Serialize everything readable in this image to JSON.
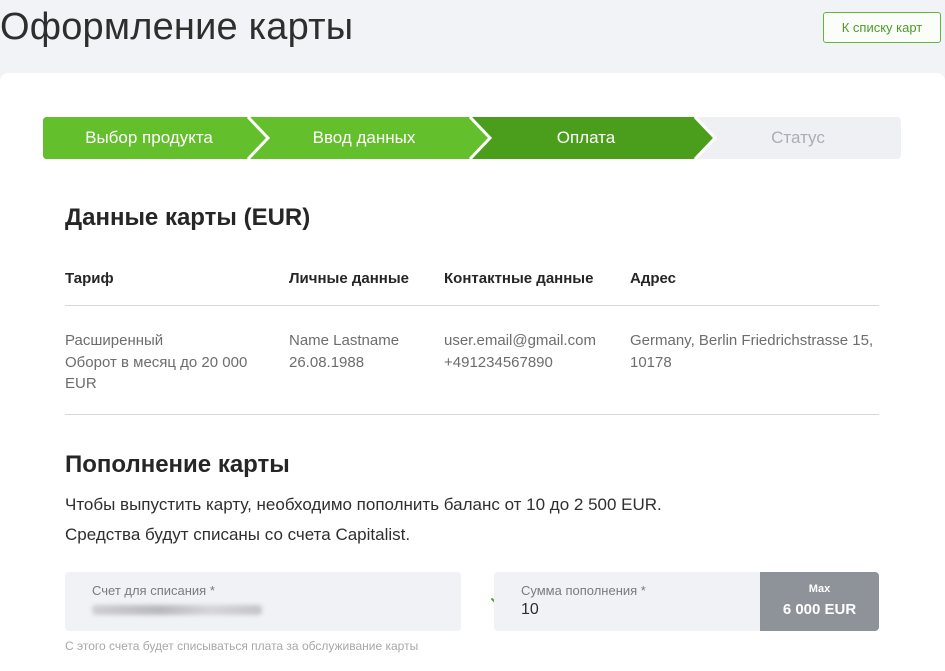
{
  "header": {
    "title": "Оформление карты",
    "back_button": "К списку карт"
  },
  "steps": [
    {
      "label": "Выбор продукта",
      "state": "done"
    },
    {
      "label": "Ввод данных",
      "state": "done"
    },
    {
      "label": "Оплата",
      "state": "active"
    },
    {
      "label": "Статус",
      "state": "inactive"
    }
  ],
  "colors": {
    "step_done": "#63bf2b",
    "step_active": "#4a9e1c",
    "step_inactive": "#eef0f3",
    "accent": "#63b63d"
  },
  "card_data": {
    "title": "Данные карты (EUR)",
    "columns": [
      "Тариф",
      "Личные данные",
      "Контактные данные",
      "Адрес"
    ],
    "tariff": [
      "Расширенный",
      "Оборот в месяц до 20 000",
      "EUR"
    ],
    "personal": [
      "Name Lastname",
      "26.08.1988"
    ],
    "contact": [
      "user.email@gmail.com",
      "+491234567890"
    ],
    "address": [
      "Germany, Berlin Friedrichstrasse 15,",
      "10178"
    ]
  },
  "topup": {
    "title": "Пополнение карты",
    "line1": "Чтобы выпустить карту, необходимо пополнить баланс от 10 до 2 500 EUR.",
    "line2": "Средства будут списаны со счета Capitalist.",
    "account_label": "Счет для списания *",
    "amount_label": "Сумма пополнения *",
    "amount_value": "10",
    "max_label": "Max",
    "max_value": "6 000 EUR",
    "hint": "С этого счета будет списываться плата за обслуживание карты"
  }
}
